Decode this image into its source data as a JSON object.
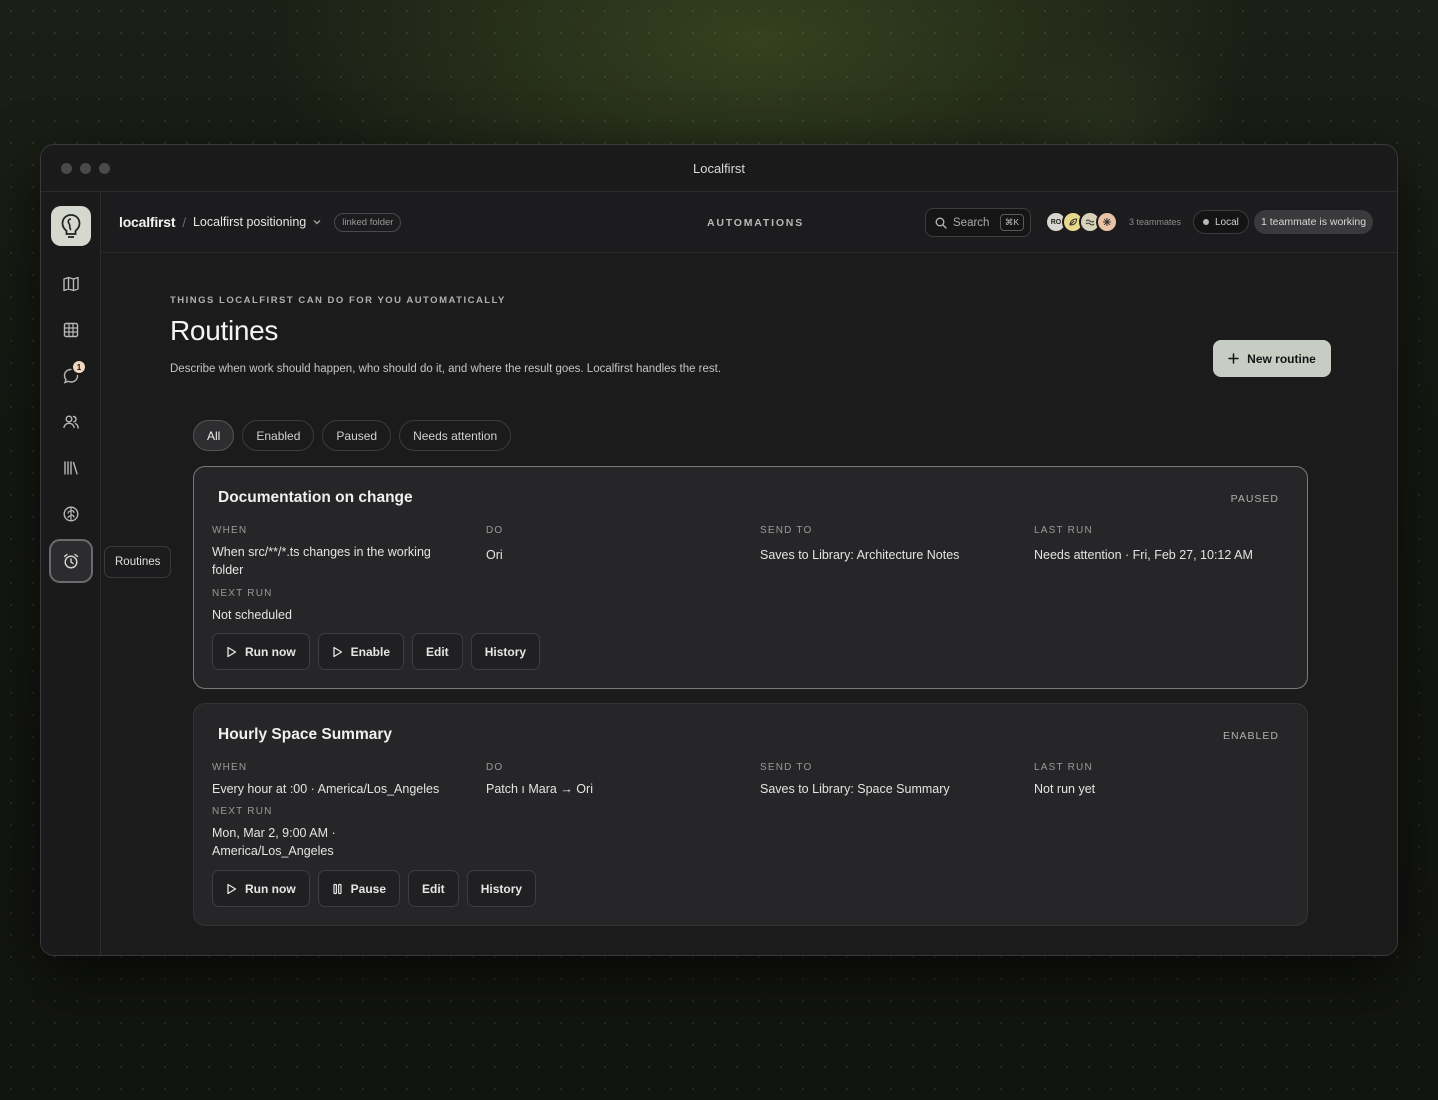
{
  "window": {
    "title": "Localfirst"
  },
  "topbar": {
    "brand": "localfirst",
    "separator": "/",
    "workspace": "Localfirst positioning",
    "linked_label": "linked folder",
    "section": "AUTOMATIONS",
    "search_label": "Search",
    "search_shortcut": "⌘K",
    "avatars": [
      {
        "initials": "RO",
        "color": "#d9d6cf"
      },
      {
        "initials": "",
        "color": "#e8d98a",
        "icon": "leaf-icon"
      },
      {
        "initials": "",
        "color": "#d8d3b8",
        "icon": "wave-icon"
      },
      {
        "initials": "",
        "color": "#e9c3a6",
        "icon": "sparkle-icon"
      }
    ],
    "teammates": "3 teammates",
    "mode": "Local",
    "working": "1 teammate is working"
  },
  "rail": {
    "items": [
      {
        "icon": "map-icon"
      },
      {
        "icon": "grid-icon"
      },
      {
        "icon": "chat-icon",
        "badge": "1"
      },
      {
        "icon": "people-icon"
      },
      {
        "icon": "library-icon"
      },
      {
        "icon": "brain-icon"
      },
      {
        "icon": "alarm-clock-icon",
        "active": true
      }
    ],
    "tooltip": "Routines"
  },
  "header": {
    "eyebrow": "THINGS LOCALFIRST CAN DO FOR YOU AUTOMATICALLY",
    "title": "Routines",
    "description": "Describe when work should happen, who should do it, and where the result goes. Localfirst handles the rest.",
    "new_button": "New routine"
  },
  "filters": [
    "All",
    "Enabled",
    "Paused",
    "Needs attention"
  ],
  "labels": {
    "when": "WHEN",
    "do": "DO",
    "send_to": "SEND TO",
    "last_run": "LAST RUN",
    "next_run": "NEXT RUN"
  },
  "routines": [
    {
      "title": "Documentation on change",
      "status": "PAUSED",
      "when": "When src/**/*.ts changes in the working folder",
      "do": "Ori",
      "send_to": "Saves to Library: Architecture Notes",
      "last_run": "Needs attention · Fri, Feb 27, 10:12 AM",
      "next_run": "Not scheduled",
      "actions": [
        "Run now",
        "Enable",
        "Edit",
        "History"
      ]
    },
    {
      "title": "Hourly Space Summary",
      "status": "ENABLED",
      "when": "Every hour at :00 · America/Los_Angeles",
      "do": "Patch ı Mara → Ori",
      "send_to": "Saves to Library: Space Summary",
      "last_run": "Not run yet",
      "next_run": "Mon, Mar 2, 9:00 AM · America/Los_Angeles",
      "actions": [
        "Run now",
        "Pause",
        "Edit",
        "History"
      ]
    }
  ],
  "colors": {
    "accent_button": "#c7cdc2",
    "card": "#262628",
    "background": "#1b1b1c"
  }
}
